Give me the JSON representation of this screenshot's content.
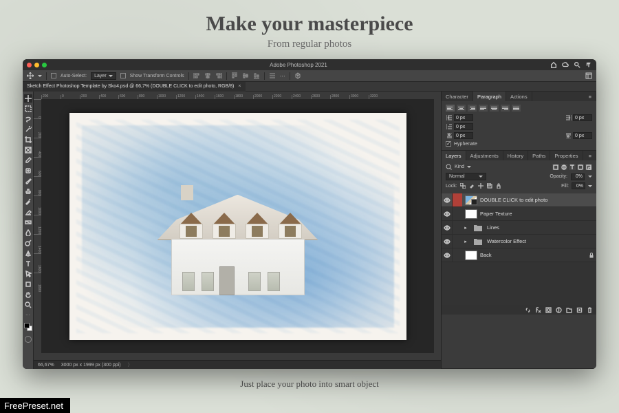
{
  "hero": {
    "script": "Make your masterpiece",
    "sub": "From regular photos"
  },
  "caption": "Just place your photo into smart object",
  "watermark": "FreePreset.net",
  "app": {
    "title": "Adobe Photoshop 2021"
  },
  "traffic": {
    "close": "#ff5f57",
    "min": "#febc2e",
    "max": "#28c840"
  },
  "options": {
    "auto_select_label": "Auto-Select:",
    "auto_select_mode": "Layer",
    "show_controls": "Show Transform Controls"
  },
  "document": {
    "tab": "Sketch Effect Photoshop Template by Sko4.psd @ 66,7% (DOUBLE CLICK to edit photo, RGB/8)"
  },
  "ruler_h": [
    "200",
    "0",
    "200",
    "400",
    "600",
    "800",
    "1000",
    "1200",
    "1400",
    "1600",
    "1800",
    "2000",
    "2200",
    "2400",
    "2600",
    "2800",
    "3000",
    "3200"
  ],
  "ruler_v": [
    "0",
    "200",
    "400",
    "600",
    "800",
    "1000",
    "1200",
    "1400",
    "1600",
    "1800"
  ],
  "status": {
    "zoom": "66,67%",
    "dims": "3000 px x 1999 px (300 ppi)"
  },
  "panels": {
    "top_tabs": [
      "Character",
      "Paragraph",
      "Actions"
    ],
    "top_active": "Paragraph",
    "paragraph": {
      "indent_left": "0 px",
      "indent_right": "0 px",
      "indent_first": "0 px",
      "space_before": "0 px",
      "space_after": "0 px",
      "hyphenate": "Hyphenate"
    },
    "mid_tabs": [
      "Layers",
      "Adjustments",
      "History",
      "Paths",
      "Properties"
    ],
    "mid_active": "Layers",
    "layers": {
      "kind_label": "Kind",
      "blend_mode": "Normal",
      "opacity_label": "Opacity:",
      "opacity_value": "0%",
      "lock_label": "Lock:",
      "fill_label": "Fill:",
      "fill_value": "0%",
      "items": [
        {
          "name": "DOUBLE CLICK to edit photo"
        },
        {
          "name": "Paper Texture"
        },
        {
          "name": "Lines"
        },
        {
          "name": "Watercolor Effect"
        },
        {
          "name": "Back"
        }
      ]
    }
  }
}
